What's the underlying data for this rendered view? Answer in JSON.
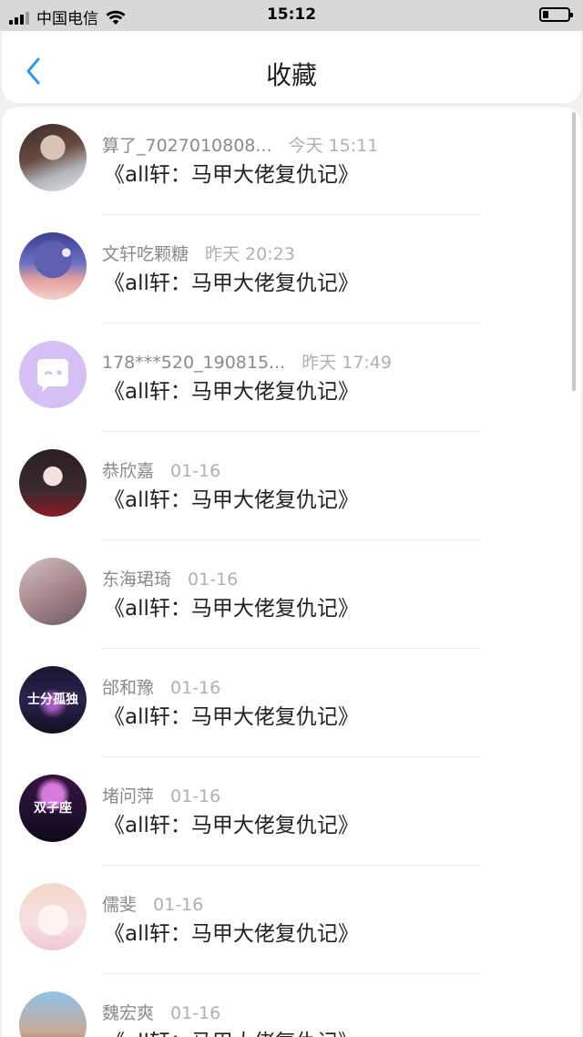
{
  "status_bar": {
    "carrier": "中国电信",
    "time": "15:12"
  },
  "header": {
    "title": "收藏",
    "back_icon": "chevron-left-icon"
  },
  "colors": {
    "accent": "#2e9ae6",
    "avatar_chat": "#d5bff5"
  },
  "favorites": [
    {
      "user": "算了_7027010808...",
      "time": "今天 15:11",
      "title": "《all轩：马甲大佬复仇记》"
    },
    {
      "user": "文轩吃颗糖",
      "time": "昨天 20:23",
      "title": "《all轩：马甲大佬复仇记》"
    },
    {
      "user": "178***520_190815...",
      "time": "昨天 17:49",
      "title": "《all轩：马甲大佬复仇记》"
    },
    {
      "user": "恭欣嘉",
      "time": "01-16",
      "title": "《all轩：马甲大佬复仇记》"
    },
    {
      "user": "东海珺琦",
      "time": "01-16",
      "title": "《all轩：马甲大佬复仇记》"
    },
    {
      "user": "邰和豫",
      "time": "01-16",
      "title": "《all轩：马甲大佬复仇记》"
    },
    {
      "user": "堵问萍",
      "time": "01-16",
      "title": "《all轩：马甲大佬复仇记》"
    },
    {
      "user": "儒斐",
      "time": "01-16",
      "title": "《all轩：马甲大佬复仇记》"
    },
    {
      "user": "魏宏爽",
      "time": "01-16",
      "title": "《all轩：马甲大佬复仇记》"
    }
  ],
  "avatar_texts": {
    "a6": "士分孤独",
    "a7": "双子座"
  }
}
